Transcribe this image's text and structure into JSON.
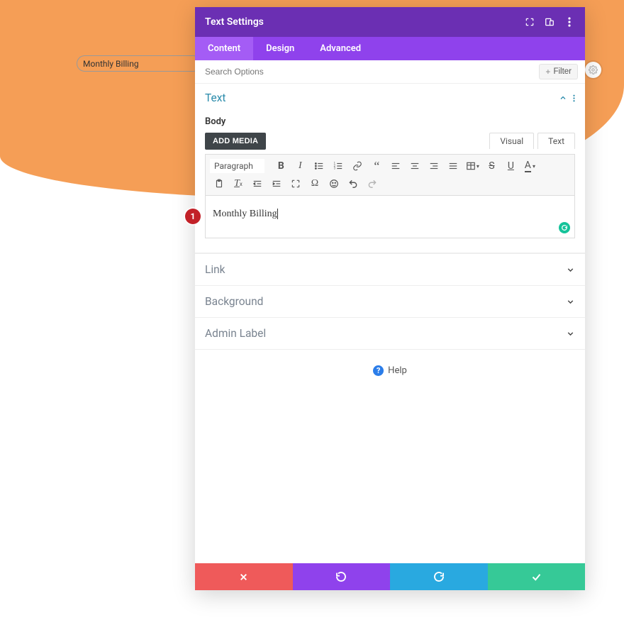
{
  "header": {
    "title": "Text Settings"
  },
  "tabs": {
    "content": "Content",
    "design": "Design",
    "advanced": "Advanced"
  },
  "search": {
    "placeholder": "Search Options",
    "filter_label": "Filter"
  },
  "section": {
    "text_title": "Text",
    "body_label": "Body",
    "add_media": "ADD MEDIA",
    "editor_tabs": {
      "visual": "Visual",
      "text": "Text"
    },
    "format_select": "Paragraph",
    "editor_content": "Monthly Billing"
  },
  "collapsed": {
    "link": "Link",
    "background": "Background",
    "admin_label": "Admin Label"
  },
  "help": {
    "label": "Help"
  },
  "bg_pill_text": "Monthly Billing",
  "step_badge": "1",
  "icons": {
    "expand": "expand-icon",
    "responsive": "responsive-icon",
    "more": "more-icon",
    "gear": "gear-icon",
    "grammarly": "grammarly-icon"
  }
}
